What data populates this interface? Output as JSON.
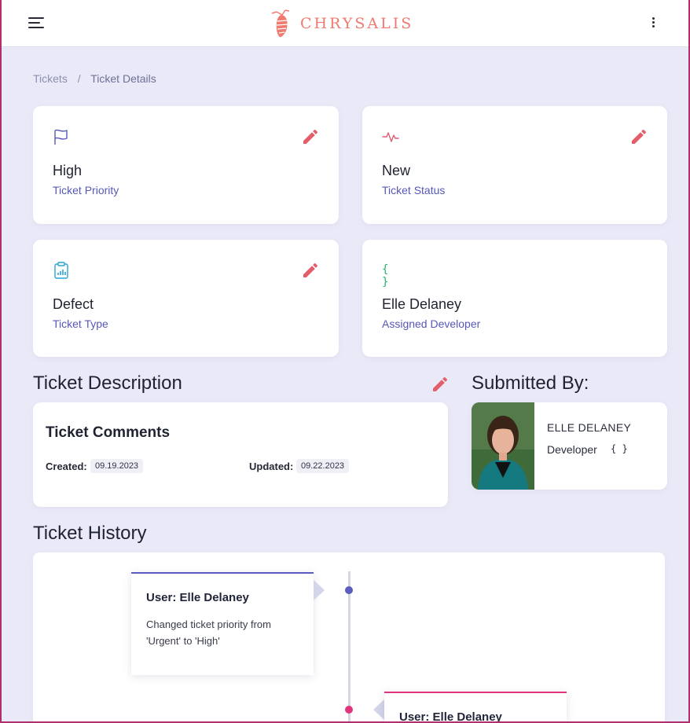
{
  "brand": {
    "name": "CHRYSALIS",
    "color": "#ef7a70",
    "logo_icon": "chrysalis-logo"
  },
  "header": {
    "menu_icon": "hamburger-menu-icon",
    "more_icon": "more-vertical-icon"
  },
  "breadcrumb": {
    "items": [
      "Tickets",
      "Ticket Details"
    ],
    "separator": "/"
  },
  "stats": [
    {
      "value": "High",
      "label": "Ticket Priority",
      "icon": "flag-icon",
      "icon_color": "#5558b8"
    },
    {
      "value": "New",
      "label": "Ticket Status",
      "icon": "activity-icon",
      "icon_color": "#e35d75"
    },
    {
      "value": "Defect",
      "label": "Ticket Type",
      "icon": "clipboard-chart-icon",
      "icon_color": "#2aa3d6"
    },
    {
      "value": "Elle Delaney",
      "label": "Assigned Developer",
      "icon": "code-braces-icon",
      "icon_color": "#23b26d",
      "icon_text": "{ }"
    }
  ],
  "description": {
    "section_title": "Ticket Description",
    "comments_title": "Ticket Comments",
    "created_label": "Created:",
    "created_value": "09.19.2023",
    "updated_label": "Updated:",
    "updated_value": "09.22.2023"
  },
  "submitted": {
    "section_title": "Submitted By:",
    "name": "ELLE DELANEY",
    "role": "Developer",
    "code": "{ }"
  },
  "history": {
    "section_title": "Ticket History",
    "entries": [
      {
        "user": "User: Elle Delaney",
        "text": "Changed ticket priority from 'Urgent' to 'High'",
        "color": "#5b5cc0"
      },
      {
        "user": "User: Elle Delaney",
        "text": "",
        "color": "#e0357c"
      }
    ]
  },
  "colors": {
    "accent_edit": "#e35d6a",
    "label_blue": "#5558b8",
    "background": "#e9e9f7"
  }
}
